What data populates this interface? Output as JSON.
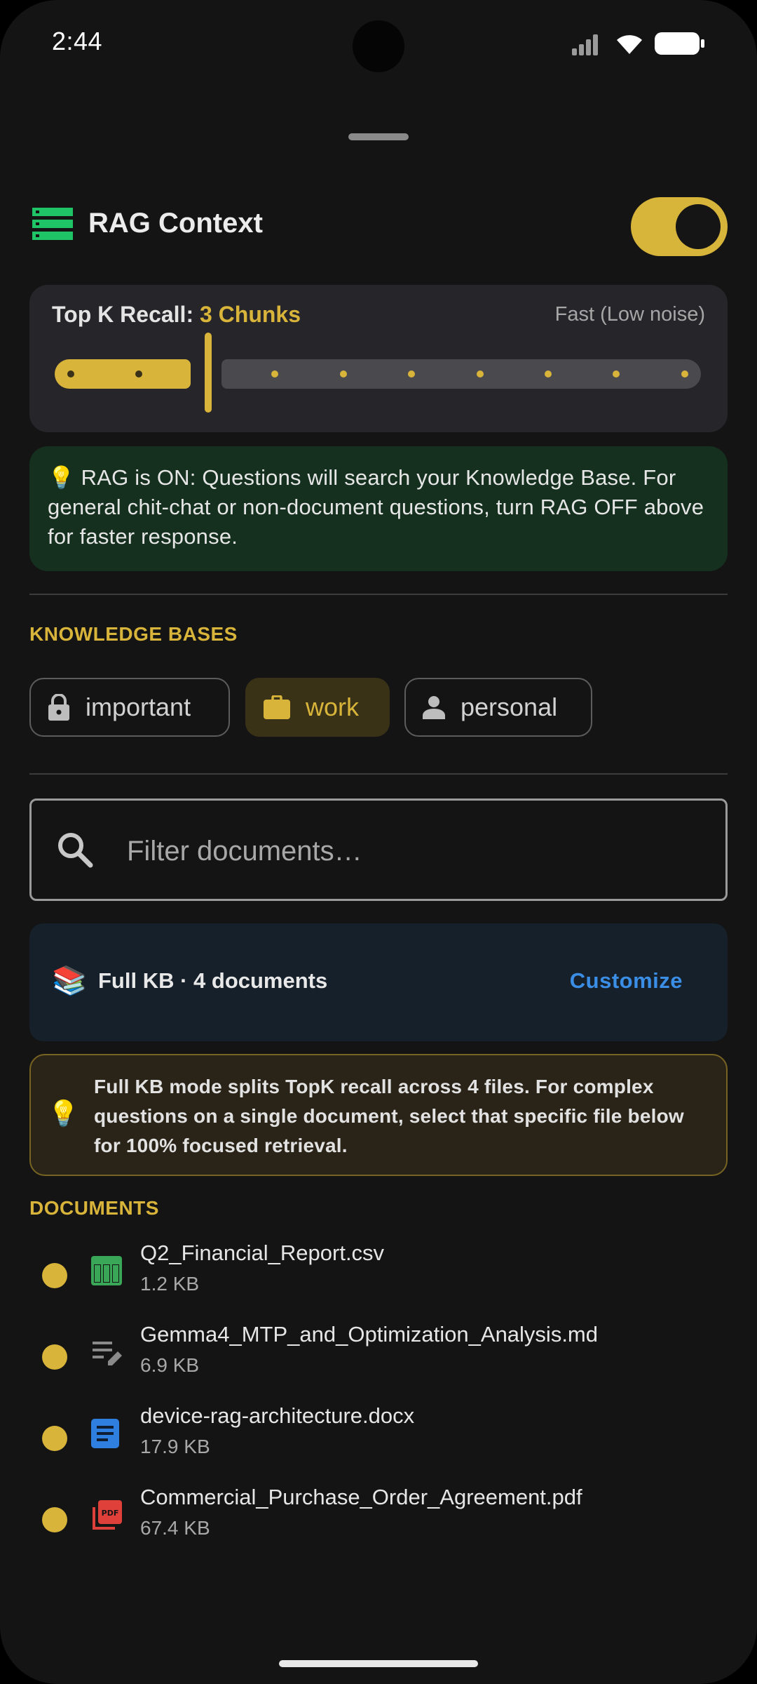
{
  "status_bar": {
    "time": "2:44"
  },
  "header": {
    "icon": "storage-icon",
    "title": "RAG Context",
    "rag_toggle_on": true
  },
  "top_k": {
    "label": "Top K Recall: ",
    "value_text": "3 Chunks",
    "hint": "Fast (Low noise)",
    "value": 3,
    "max": 10
  },
  "rag_info": {
    "icon": "💡",
    "text": "RAG is ON: Questions will search your Knowledge Base. For general chit-chat or non-document questions, turn RAG OFF above for faster response."
  },
  "knowledge_bases": {
    "label": "KNOWLEDGE BASES",
    "items": [
      {
        "label": "important",
        "icon": "lock-icon",
        "selected": false
      },
      {
        "label": "work",
        "icon": "briefcase-icon",
        "selected": true
      },
      {
        "label": "personal",
        "icon": "person-icon",
        "selected": false
      }
    ]
  },
  "search": {
    "placeholder": "Filter documents…",
    "value": ""
  },
  "full_kb": {
    "icon": "📚",
    "text": "Full KB · 4 documents",
    "action": "Customize"
  },
  "note": {
    "icon": "💡",
    "text": "Full KB mode splits TopK recall across 4 files. For complex questions on a single document, select that specific file below for 100% focused retrieval."
  },
  "documents": {
    "label": "DOCUMENTS",
    "items": [
      {
        "name": "Q2_Financial_Report.csv",
        "size": "1.2 KB",
        "icon": "table-icon",
        "color": "#3aa657"
      },
      {
        "name": "Gemma4_MTP_and_Optimization_Analysis.md",
        "size": "6.9 KB",
        "icon": "notes-icon",
        "color": "#8a8a8a"
      },
      {
        "name": "device-rag-architecture.docx",
        "size": "17.9 KB",
        "icon": "document-icon",
        "color": "#2f7fe0"
      },
      {
        "name": "Commercial_Purchase_Order_Agreement.pdf",
        "size": "67.4 KB",
        "icon": "pdf-icon",
        "color": "#e0403a"
      }
    ]
  },
  "colors": {
    "accent": "#d8b43a",
    "background": "#141414",
    "link": "#3b8ee6",
    "info_bg": "#15301f"
  }
}
